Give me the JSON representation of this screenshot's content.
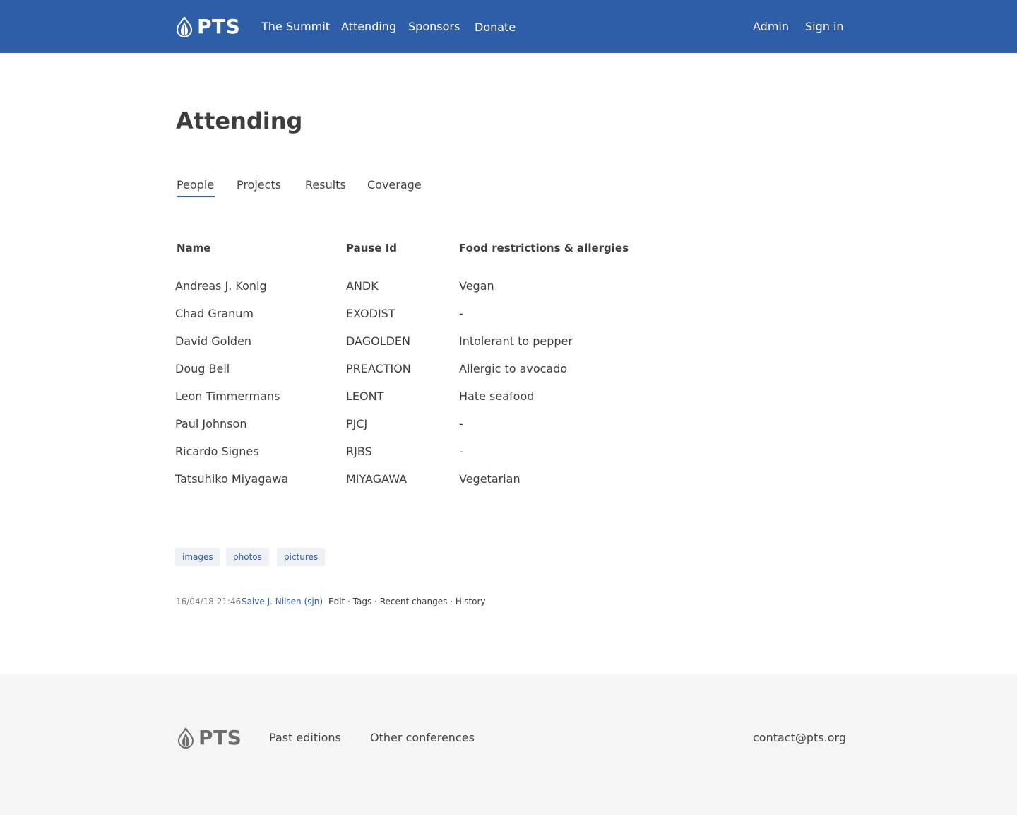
{
  "header": {
    "brand": "PTS",
    "nav": [
      "The Summit",
      "Attending",
      "Sponsors",
      "Donate"
    ],
    "admin": "Admin",
    "signin": "Sign in"
  },
  "page": {
    "title": "Attending",
    "tabs": [
      "People",
      "Projects",
      "Results",
      "Coverage"
    ],
    "active_tab": "People"
  },
  "table": {
    "columns": [
      "Name",
      "Pause Id",
      "Food restrictions & allergies"
    ],
    "rows": [
      [
        "Andreas J. Konig",
        "ANDK",
        "Vegan"
      ],
      [
        "Chad Granum",
        "EXODIST",
        "-"
      ],
      [
        "David Golden",
        "DAGOLDEN",
        "Intolerant to pepper"
      ],
      [
        "Doug Bell",
        "PREACTION",
        "Allergic to avocado"
      ],
      [
        "Leon Timmermans",
        "LEONT",
        "Hate seafood"
      ],
      [
        "Paul Johnson",
        "PJCJ",
        "-"
      ],
      [
        "Ricardo Signes",
        "RJBS",
        "-"
      ],
      [
        "Tatsuhiko Miyagawa",
        "MIYAGAWA",
        "Vegetarian"
      ]
    ]
  },
  "tags": [
    "images",
    "photos",
    "pictures"
  ],
  "meta": {
    "timestamp": "16/04/18 21:46 ·",
    "author": "Salve J. Nilsen (sjn)",
    "actions": "Edit · Tags · Recent changes · History"
  },
  "footer": {
    "brand": "PTS",
    "links": [
      "Past editions",
      "Other conferences"
    ],
    "contact": "contact@pts.org"
  },
  "colors": {
    "header_bg": "#2f5ea8",
    "accent": "#2f5ea8",
    "footer_bg": "#f5f5f5",
    "tag_bg": "#edf1f5"
  },
  "icons": [
    "onion-logo-icon"
  ]
}
